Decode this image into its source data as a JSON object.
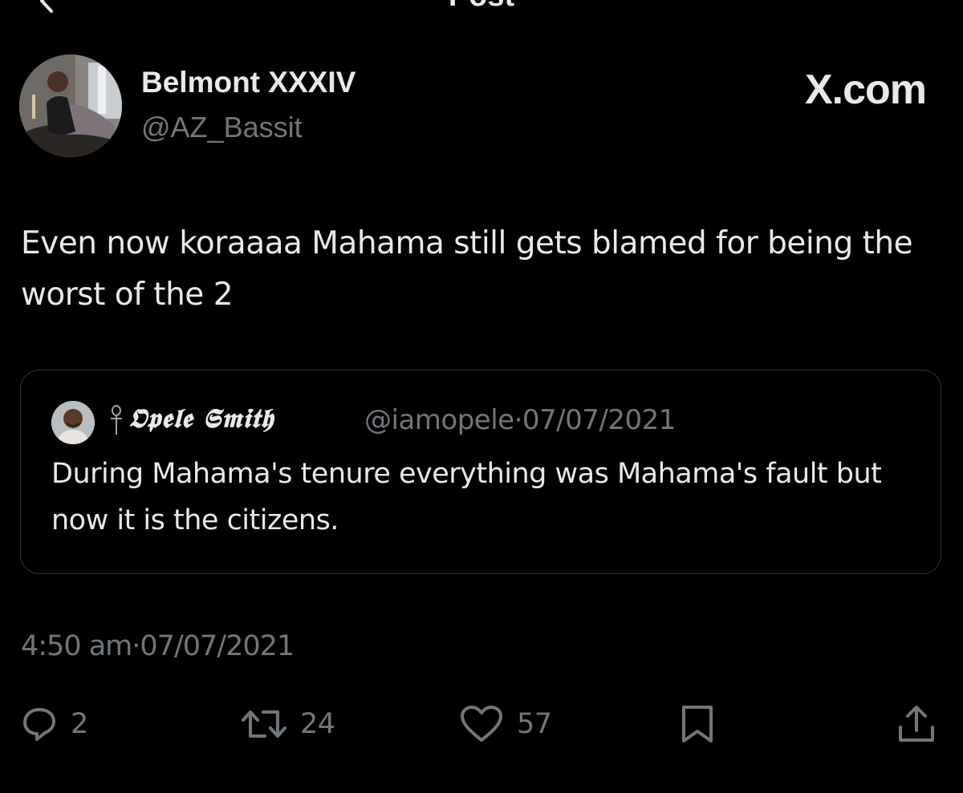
{
  "header": {
    "title": "Post",
    "back_icon": "chevron-left-icon"
  },
  "author": {
    "name": "Belmont XXXIV",
    "handle": "@AZ_Bassit"
  },
  "brand": "X.com",
  "tweet": {
    "text": "Even now koraaaa Mahama still gets blamed for being the worst of the 2"
  },
  "quote": {
    "symbol": "ankh-icon",
    "name": "𝕺𝖕𝖊𝖑𝖊 𝕾𝖒𝖎𝖙𝖍",
    "handle": "@iamopele",
    "separator": "·",
    "date": "07/07/2021",
    "text": "During Mahama's tenure everything was Mahama's fault but now it is the citizens."
  },
  "timestamp": {
    "time": "4:50 am",
    "separator": "·",
    "date": "07/07/2021"
  },
  "actions": {
    "replies": "2",
    "reposts": "24",
    "likes": "57"
  },
  "colors": {
    "background": "#000000",
    "text_primary": "#e7e9ea",
    "text_secondary": "#71767b",
    "border": "#2f3336"
  }
}
